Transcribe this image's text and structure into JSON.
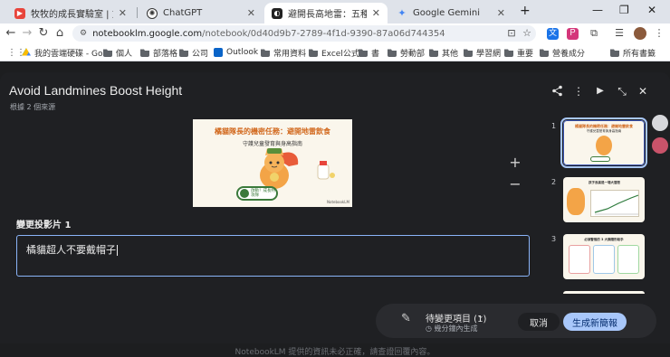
{
  "browser": {
    "tabs": [
      {
        "title": "牧牧的成長實驗室 | 方格子 vo",
        "active": false,
        "color": "#e8453c"
      },
      {
        "title": "ChatGPT",
        "active": false,
        "color": "#444"
      },
      {
        "title": "避開長高地雷：五種奶罐發育的",
        "active": true,
        "color": "#333"
      },
      {
        "title": "Google Gemini",
        "active": false,
        "color": "#4285f4"
      }
    ],
    "new_tab": "+",
    "url_host": "notebooklm.google.com",
    "url_path": "/notebook/0d40d9b7-2789-4f1d-9390-87a06d744354",
    "bookmarks": [
      {
        "label": "我的雲端硬碟 - Go...",
        "kind": "drive"
      },
      {
        "label": "個人",
        "kind": "folder"
      },
      {
        "label": "部落格",
        "kind": "folder"
      },
      {
        "label": "公司",
        "kind": "folder"
      },
      {
        "label": "Outlook",
        "kind": "outlook"
      },
      {
        "label": "常用資料",
        "kind": "folder"
      },
      {
        "label": "Excel公式",
        "kind": "folder"
      },
      {
        "label": "書",
        "kind": "folder"
      },
      {
        "label": "勞動部",
        "kind": "folder"
      },
      {
        "label": "其他",
        "kind": "folder"
      },
      {
        "label": "學習網",
        "kind": "folder"
      },
      {
        "label": "重要",
        "kind": "folder"
      },
      {
        "label": "營養成分",
        "kind": "folder"
      },
      {
        "label": "所有書籤",
        "kind": "folder"
      }
    ]
  },
  "modal": {
    "title": "Avoid Landmines Boost Height",
    "subtitle": "根據 2 個來源",
    "slide": {
      "headline": "橘貓隊長的機密任務：避開地雷飲食",
      "subhead": "守護兒童發育與身高指南",
      "badge": "啟動！成長特攻隊",
      "logo": "NotebookLM"
    },
    "section_label": "變更投影片 1",
    "edit_text": "橘貓超人不要戴帽子",
    "thumbnails": [
      {
        "num": "1",
        "caption": "橘貓隊長的機密任務：避開地雷飲食",
        "sub": "守護兒童發育與身高指南"
      },
      {
        "num": "2",
        "caption": "孩子長高是一場大冒險"
      },
      {
        "num": "3",
        "caption": "必須警惕的 3 大類隱形殺手"
      }
    ],
    "action_bar": {
      "pending": "待變更項目 (1)",
      "pending_sub": "幾分鐘內生成",
      "cancel": "取消",
      "generate": "生成新簡報"
    }
  },
  "page_footnote": "NotebookLM 提供的資訊未必正確，請查證回覆內容。",
  "colors": {
    "accent": "#a8c7fa",
    "modal_bg": "#1f2023"
  }
}
